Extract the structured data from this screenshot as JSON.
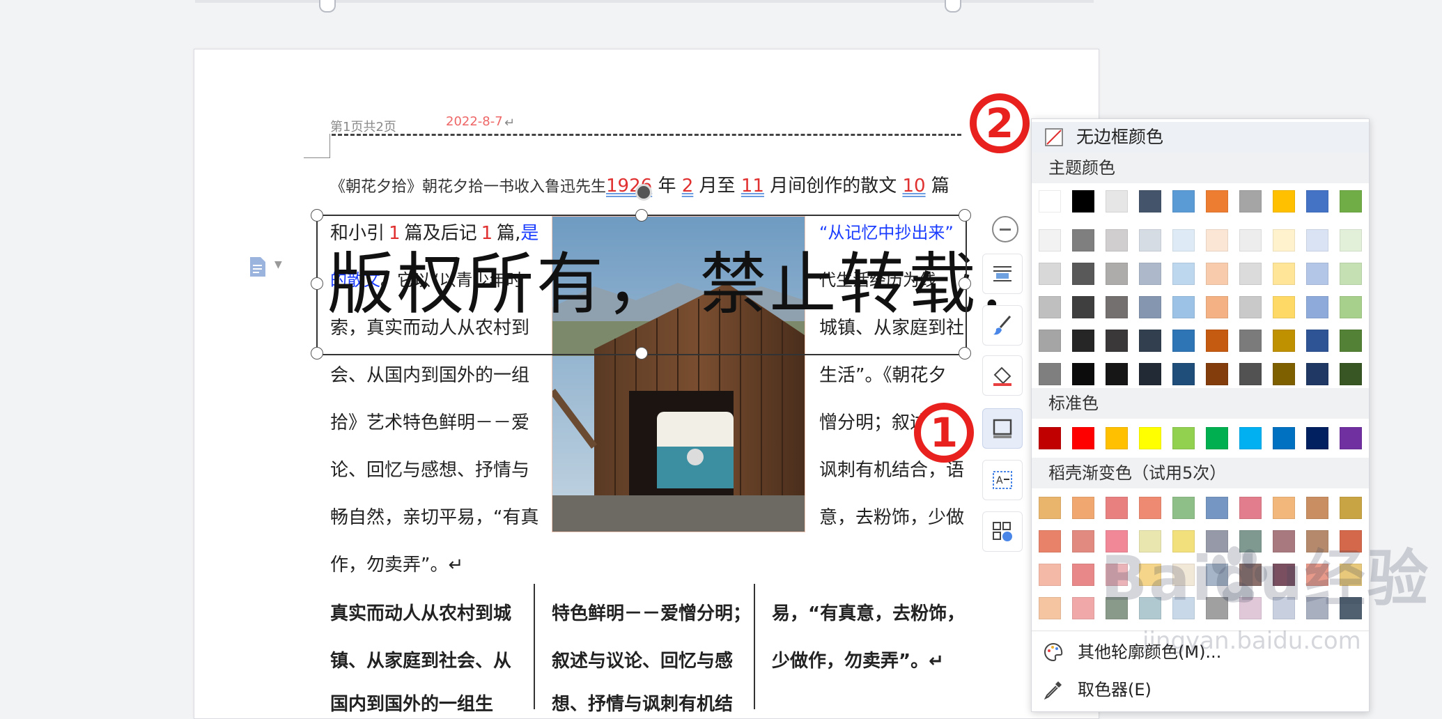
{
  "header": {
    "page_info": "第1页共2页",
    "date": "2022-8-7",
    "return_mark": "↵"
  },
  "doc": {
    "line1_a": "《朝花夕拾》朝花夕拾一书收入鲁迅先生",
    "line1_year": "1926",
    "line1_b": "年",
    "line1_m1": "2",
    "line1_c": "月至",
    "line1_m2": "11",
    "line1_d": "月间创作的散文",
    "line1_n": "10",
    "line1_e": "篇",
    "line2_a": "和小引",
    "line2_n": "1",
    "line2_b": "篇及后记",
    "line2_n2": "1",
    "line2_c": "篇,",
    "line2_blue": "是",
    "line2_right": "“从记忆中抄出来”",
    "line3_blue": "的散文",
    "line3_a": "。它以“以青少年时",
    "line3_right": "代生活经历为线",
    "line4_left": "索，真实而动人从农村到",
    "line4_right": "城镇、从家庭到社",
    "line5_left": "会、从国内到国外的一组",
    "line5_right": "生活”。《朝花夕",
    "line6_left": "拾》艺术特色鲜明－－爱",
    "line6_right": "憎分明；叙述与议",
    "line7_left": "论、回忆与感想、抒情与",
    "line7_right": "讽刺有机结合，语",
    "line8_left": "畅自然，亲切平易，“有真",
    "line8_right": "意，去粉饰，少做",
    "line9": "作，勿卖弄”。↵",
    "col1_l1": "真实而动人从农村到城",
    "col1_l2": "镇、从家庭到社会、从",
    "col1_l3": "国内到国外的一组生",
    "col2_l1": "特色鲜明－－爱憎分明；",
    "col2_l2": "叙述与议论、回忆与感",
    "col2_l3": "想、抒情与讽刺有机结",
    "col3_l1": "易，“有真意，去粉饰，",
    "col3_l2": "少做作，勿卖弄”。↵",
    "watermark": "版权所有，  禁止转载!"
  },
  "markers": {
    "one": "1",
    "two": "2"
  },
  "menu": {
    "no_border": "无边框颜色",
    "theme_colors": "主题颜色",
    "standard_colors": "标准色",
    "gradient": "稻壳渐变色（试用5次）",
    "more_colors": "其他轮廓颜色(M)...",
    "picker": "取色器(E)",
    "theme_swatches": [
      [
        "#ffffff",
        "#000000",
        "#e7e6e6",
        "#44546a",
        "#5b9bd5",
        "#ed7d31",
        "#a5a5a5",
        "#ffc000",
        "#4472c4",
        "#70ad47"
      ],
      [
        "#f2f2f2",
        "#7f7f7f",
        "#d0cece",
        "#d6dce4",
        "#deebf6",
        "#fbe5d5",
        "#ededed",
        "#fff2cc",
        "#dae3f3",
        "#e2efd9"
      ],
      [
        "#d8d8d8",
        "#595959",
        "#aeabab",
        "#adb9ca",
        "#bdd7ee",
        "#f7cbac",
        "#dbdbdb",
        "#ffe598",
        "#b4c6e7",
        "#c5e0b3"
      ],
      [
        "#bfbfbf",
        "#3f3f3f",
        "#757070",
        "#8496b0",
        "#9cc3e5",
        "#f4b183",
        "#c9c9c9",
        "#ffd965",
        "#8eaadb",
        "#a8d08d"
      ],
      [
        "#a5a5a5",
        "#262626",
        "#3a3838",
        "#323f4f",
        "#2e75b5",
        "#c55a11",
        "#7b7b7b",
        "#bf9000",
        "#2f5496",
        "#538135"
      ],
      [
        "#7f7f7f",
        "#0c0c0c",
        "#171616",
        "#222a35",
        "#1e4e79",
        "#833c0b",
        "#525252",
        "#7f6000",
        "#1f3864",
        "#375623"
      ]
    ],
    "standard_swatches": [
      "#c00000",
      "#ff0000",
      "#ffc000",
      "#ffff00",
      "#92d050",
      "#00b050",
      "#00b0f0",
      "#0070c0",
      "#002060",
      "#7030a0"
    ],
    "gradient_swatches": [
      [
        "#e9b56d",
        "#f0a870",
        "#e98080",
        "#ee8a72",
        "#8fbf88",
        "#7596c2",
        "#e27d8d",
        "#f2b77a",
        "#c98f62",
        "#c8a445"
      ],
      [
        "#e8836a",
        "#e08a80",
        "#f08898",
        "#e9e6b0",
        "#f2e07c",
        "#969aa8",
        "#7f9990",
        "#a87a80",
        "#b58a6c",
        "#d4684a"
      ],
      [
        "#f5b9a8",
        "#e98888",
        "#e9b3b8",
        "#f4d58a",
        "#f2e8d8",
        "#a6b5c8",
        "#8a6f6a",
        "#7a5060",
        "#e89a8a",
        "#e8c87a"
      ],
      [
        "#f5c4a0",
        "#f0a8a8",
        "#8a9a8a",
        "#b0c8d0",
        "#c8d8e8",
        "#a0a0a0",
        "#e0c8d8",
        "#c8d0e0",
        "#a8b0c0",
        "#506070"
      ]
    ]
  },
  "watermark_site": {
    "brand": "Baidu经验",
    "url": "jingyan.baidu.com"
  }
}
